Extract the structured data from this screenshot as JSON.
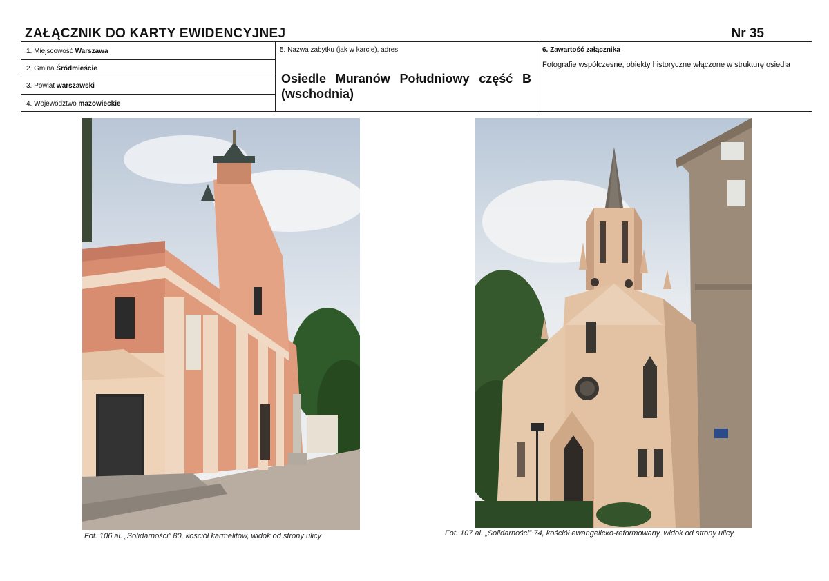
{
  "header": {
    "title": "ZAŁĄCZNIK DO KARTY EWIDENCYJNEJ",
    "number": "Nr 35"
  },
  "fields": {
    "miejscowosc_label": "1. Miejscowość",
    "miejscowosc_value": "Warszawa",
    "gmina_label": "2. Gmina",
    "gmina_value": "Śródmieście",
    "powiat_label": "3. Powiat",
    "powiat_value": "warszawski",
    "wojewodztwo_label": "4. Województwo",
    "wojewodztwo_value": "mazowieckie",
    "nazwa_label": "5. Nazwa zabytku (jak w karcie), adres",
    "nazwa_value": "Osiedle Muranów Południowy część B (wschodnia)",
    "zawartosc_label": "6. Zawartość załącznika",
    "zawartosc_value": "Fotografie współczesne, obiekty historyczne włączone w strukturę osiedla"
  },
  "photos": [
    {
      "caption": "Fot. 106 al. „Solidarności” 80, kościół karmelitów, widok od strony ulicy",
      "subject": "baroque-church-photo",
      "colors": {
        "facade": "#d98f73",
        "pilaster": "#efd9c3",
        "sky": "#dfe6ee",
        "tree": "#2f5a2a"
      }
    },
    {
      "caption": "Fot. 107 al. „Solidarności” 74, kościół ewangelicko-reformowany, widok od strony ulicy",
      "subject": "neo-gothic-church-photo",
      "colors": {
        "facade": "#e2bfa0",
        "shadow": "#a98466",
        "sky": "#e8ebef",
        "building": "#9a8a78"
      }
    }
  ]
}
